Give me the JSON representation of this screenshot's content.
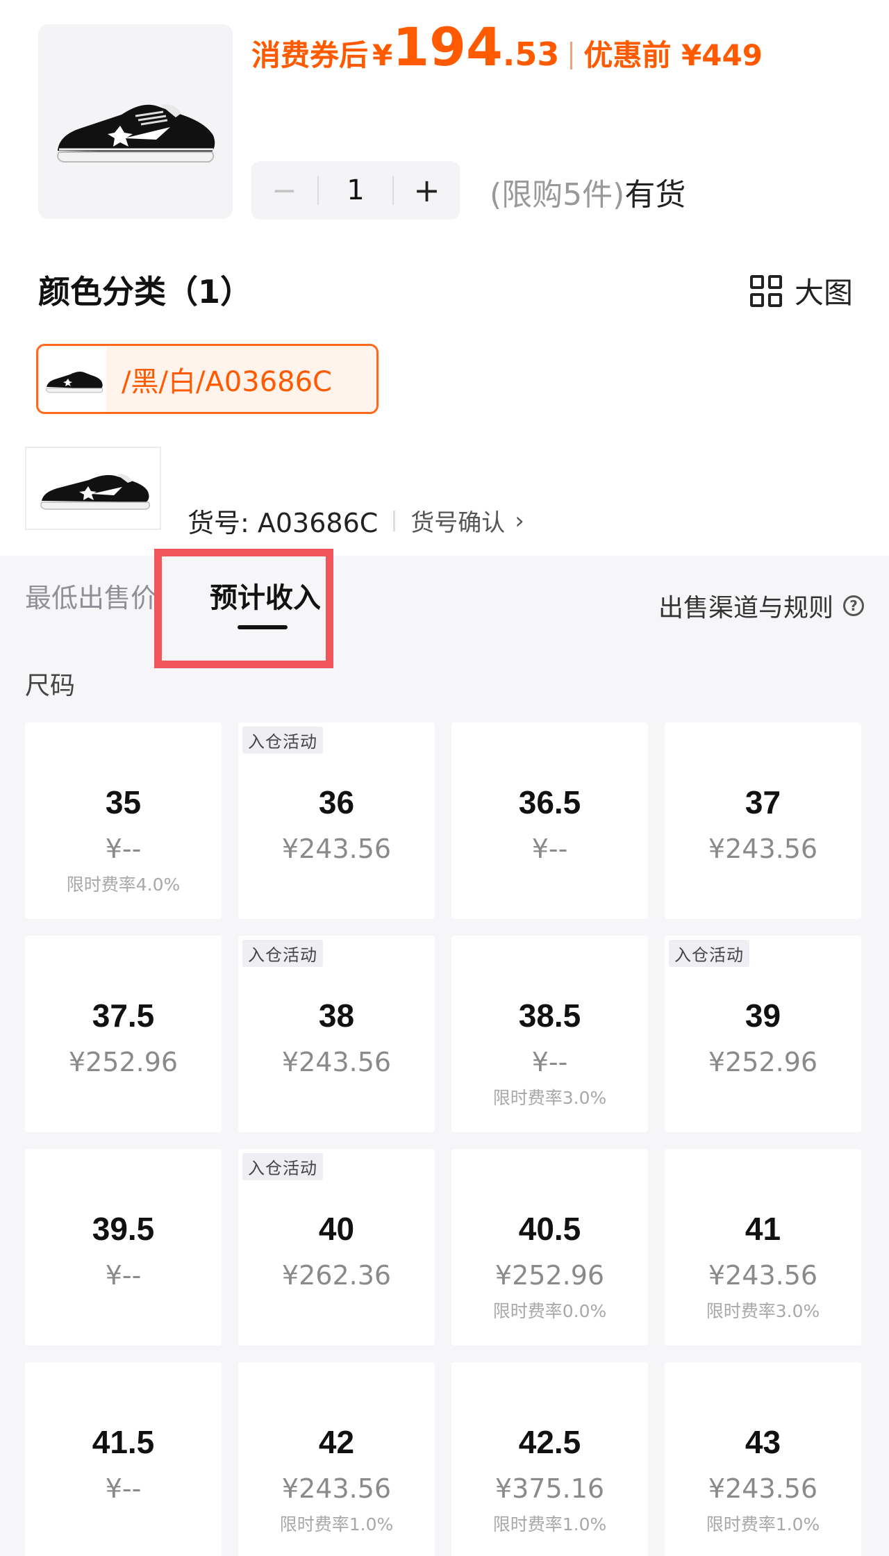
{
  "header": {
    "coupon_label": "消费券后",
    "price_yen": "¥",
    "price_int": "194",
    "price_dec": ".53",
    "before_label": "优惠前 ¥449",
    "accent_color": "#ff5a00"
  },
  "stepper": {
    "minus": "−",
    "qty": "1",
    "plus": "+"
  },
  "stock": {
    "limit": "(限购5件)",
    "status": "有货"
  },
  "color_section": {
    "title": "颜色分类（1）",
    "big_view": "大图",
    "chip_label": "/黑/白/A03686C"
  },
  "article": {
    "label": "货号: A03686C",
    "confirm": "货号确认"
  },
  "tabs": {
    "lowest": "最低出售价",
    "expected": "预计收入",
    "rules": "出售渠道与规则",
    "help": "?"
  },
  "sizes_label": "尺码",
  "sizes": [
    {
      "size": "35",
      "price": "¥--",
      "badge": "",
      "fee": "限时费率4.0%"
    },
    {
      "size": "36",
      "price": "¥243.56",
      "badge": "入仓活动",
      "fee": ""
    },
    {
      "size": "36.5",
      "price": "¥--",
      "badge": "",
      "fee": ""
    },
    {
      "size": "37",
      "price": "¥243.56",
      "badge": "",
      "fee": ""
    },
    {
      "size": "37.5",
      "price": "¥252.96",
      "badge": "",
      "fee": ""
    },
    {
      "size": "38",
      "price": "¥243.56",
      "badge": "入仓活动",
      "fee": ""
    },
    {
      "size": "38.5",
      "price": "¥--",
      "badge": "",
      "fee": "限时费率3.0%"
    },
    {
      "size": "39",
      "price": "¥252.96",
      "badge": "入仓活动",
      "fee": ""
    },
    {
      "size": "39.5",
      "price": "¥--",
      "badge": "",
      "fee": ""
    },
    {
      "size": "40",
      "price": "¥262.36",
      "badge": "入仓活动",
      "fee": ""
    },
    {
      "size": "40.5",
      "price": "¥252.96",
      "badge": "",
      "fee": "限时费率0.0%"
    },
    {
      "size": "41",
      "price": "¥243.56",
      "badge": "",
      "fee": "限时费率3.0%"
    },
    {
      "size": "41.5",
      "price": "¥--",
      "badge": "",
      "fee": ""
    },
    {
      "size": "42",
      "price": "¥243.56",
      "badge": "",
      "fee": "限时费率1.0%"
    },
    {
      "size": "42.5",
      "price": "¥375.16",
      "badge": "",
      "fee": "限时费率1.0%"
    },
    {
      "size": "43",
      "price": "¥243.56",
      "badge": "",
      "fee": "限时费率1.0%"
    }
  ]
}
